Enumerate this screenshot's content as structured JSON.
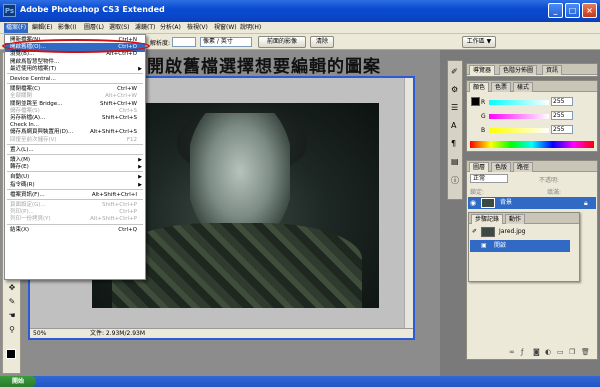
{
  "app": {
    "title": "Adobe Photoshop CS3 Extended",
    "logo": "Ps"
  },
  "window_controls": [
    "_",
    "□",
    "×"
  ],
  "menubar": {
    "items": [
      "檔案(F)",
      "編輯(E)",
      "影像(I)",
      "圖層(L)",
      "選取(S)",
      "濾鏡(T)",
      "分析(A)",
      "檢視(V)",
      "視窗(W)",
      "說明(H)"
    ]
  },
  "options_bar": {
    "resolution_label": "解析度:",
    "unit_value": "像素 / 英寸",
    "front_image_button": "前面的影像",
    "clear_button": "清除",
    "workspace_label": "工作區 ▼"
  },
  "caption": "開啟舊檔選擇想要編輯的圖案",
  "file_menu": {
    "rows": [
      {
        "text": "開新檔案(N)...",
        "key": "Ctrl+N",
        "disabled": false
      },
      {
        "text": "開啟舊檔(O)...",
        "key": "Ctrl+O",
        "disabled": false,
        "highlight": true
      },
      {
        "text": "瀏覽(B)...",
        "key": "Alt+Ctrl+O",
        "disabled": false
      },
      {
        "text": "開啟爲智慧型物件...",
        "key": "",
        "disabled": false
      },
      {
        "text": "最近使用的檔案(T)",
        "key": "",
        "disabled": false,
        "submenu": true
      },
      {
        "sep": true
      },
      {
        "text": "Device Central...",
        "key": "",
        "disabled": false
      },
      {
        "sep": true
      },
      {
        "text": "關閉檔案(C)",
        "key": "Ctrl+W",
        "disabled": false
      },
      {
        "text": "全部關閉",
        "key": "Alt+Ctrl+W",
        "disabled": true
      },
      {
        "text": "關閉並跳至 Bridge...",
        "key": "Shift+Ctrl+W",
        "disabled": false
      },
      {
        "text": "儲存檔案(S)",
        "key": "Ctrl+S",
        "disabled": true
      },
      {
        "text": "另存新檔(A)...",
        "key": "Shift+Ctrl+S",
        "disabled": false
      },
      {
        "text": "Check In...",
        "key": "",
        "disabled": false
      },
      {
        "text": "儲存爲網頁與裝置用(D)...",
        "key": "Alt+Shift+Ctrl+S",
        "disabled": false
      },
      {
        "text": "回復至前次儲存(V)",
        "key": "F12",
        "disabled": true
      },
      {
        "sep": true
      },
      {
        "text": "置入(L)...",
        "key": "",
        "disabled": false
      },
      {
        "sep": true
      },
      {
        "text": "讀入(M)",
        "key": "",
        "disabled": false,
        "submenu": true
      },
      {
        "text": "轉存(E)",
        "key": "",
        "disabled": false,
        "submenu": true
      },
      {
        "sep": true
      },
      {
        "text": "自動(U)",
        "key": "",
        "disabled": false,
        "submenu": true
      },
      {
        "text": "指令碼(R)",
        "key": "",
        "disabled": false,
        "submenu": true
      },
      {
        "sep": true
      },
      {
        "text": "檔案資訊(F)...",
        "key": "Alt+Shift+Ctrl+I",
        "disabled": false
      },
      {
        "sep": true
      },
      {
        "text": "頁面設定(G)...",
        "key": "Shift+Ctrl+P",
        "disabled": true
      },
      {
        "text": "列印(P)...",
        "key": "Ctrl+P",
        "disabled": true
      },
      {
        "text": "列印一份拷貝(Y)",
        "key": "Alt+Shift+Ctrl+P",
        "disabled": true
      },
      {
        "sep": true
      },
      {
        "text": "結束(X)",
        "key": "Ctrl+Q",
        "disabled": false
      }
    ]
  },
  "document": {
    "zoom": "50%",
    "doc_info": "文件: 2.93M/2.93M"
  },
  "navigator_panel": {
    "tabs": [
      "導覽器",
      "色階分佈圖",
      "資訊"
    ]
  },
  "color_panel": {
    "tabs": [
      "顏色",
      "色票",
      "樣式"
    ],
    "channels": [
      {
        "name": "R",
        "value": "255",
        "gradient": "#ff0000"
      },
      {
        "name": "G",
        "value": "255",
        "gradient": "#00c000"
      },
      {
        "name": "B",
        "value": "255",
        "gradient": "#0000ff"
      }
    ]
  },
  "layers_panel": {
    "tabs": [
      "圖層",
      "色版",
      "路徑"
    ],
    "blend_mode": "正常",
    "opacity_label": "不透明:",
    "lock_label": "鎖定:",
    "fill_label": "填滿:",
    "layer_name": "背景"
  },
  "history_panel": {
    "tabs": [
      "步驟記錄",
      "動作"
    ],
    "snapshot": "Jared.jpg",
    "step": "開啟"
  },
  "taskbar": {
    "start": "開始"
  }
}
